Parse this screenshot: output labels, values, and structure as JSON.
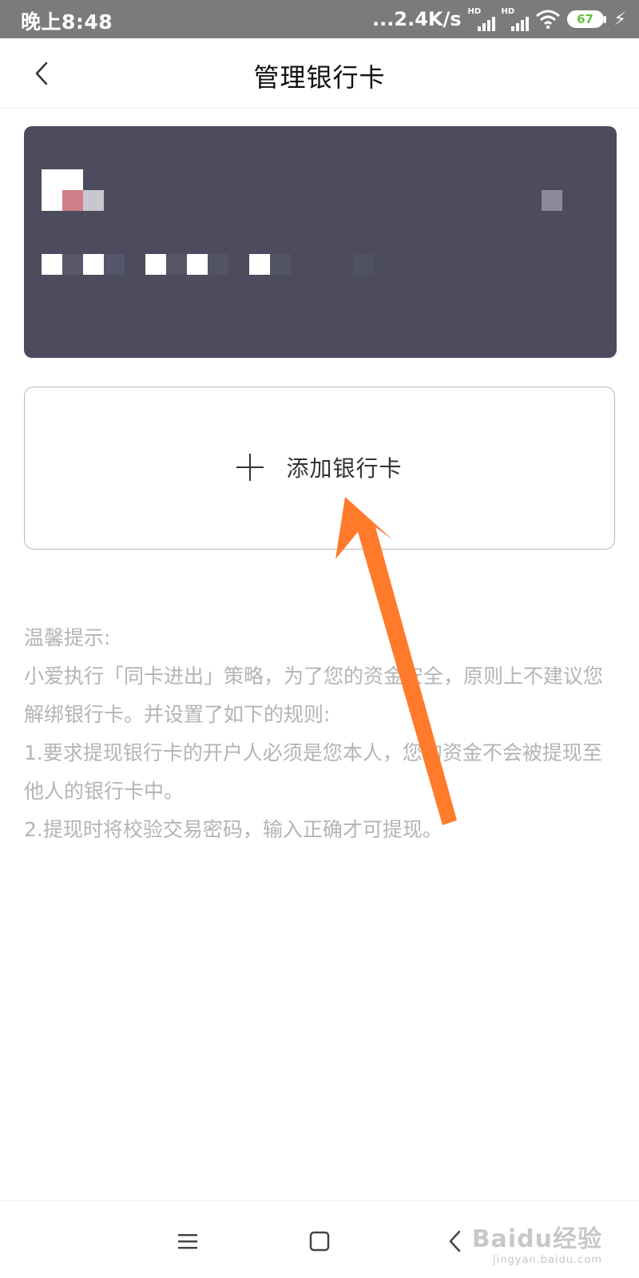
{
  "status_bar": {
    "time": "晚上8:48",
    "network_speed": "...2.4K/s",
    "signal_label": "HD",
    "battery_level": "67"
  },
  "header": {
    "title": "管理银行卡"
  },
  "add_card": {
    "label": "添加银行卡"
  },
  "tips": {
    "heading": "温馨提示:",
    "lines": [
      "小爱执行「同卡进出」策略，为了您的资金安全，原则上不建议您解绑银行卡。并设置了如下的规则:",
      "1.要求提现银行卡的开户人必须是您本人，您的资金不会被提现至他人的银行卡中。",
      "2.提现时将校验交易密码，输入正确才可提现。"
    ]
  },
  "watermark": {
    "brand": "Baidu经验",
    "url": "jingyan.baidu.com"
  },
  "colors": {
    "card_background": "#4c4c5e",
    "annotation_arrow": "#ff7a2a",
    "tip_text": "#b4b4b4"
  }
}
